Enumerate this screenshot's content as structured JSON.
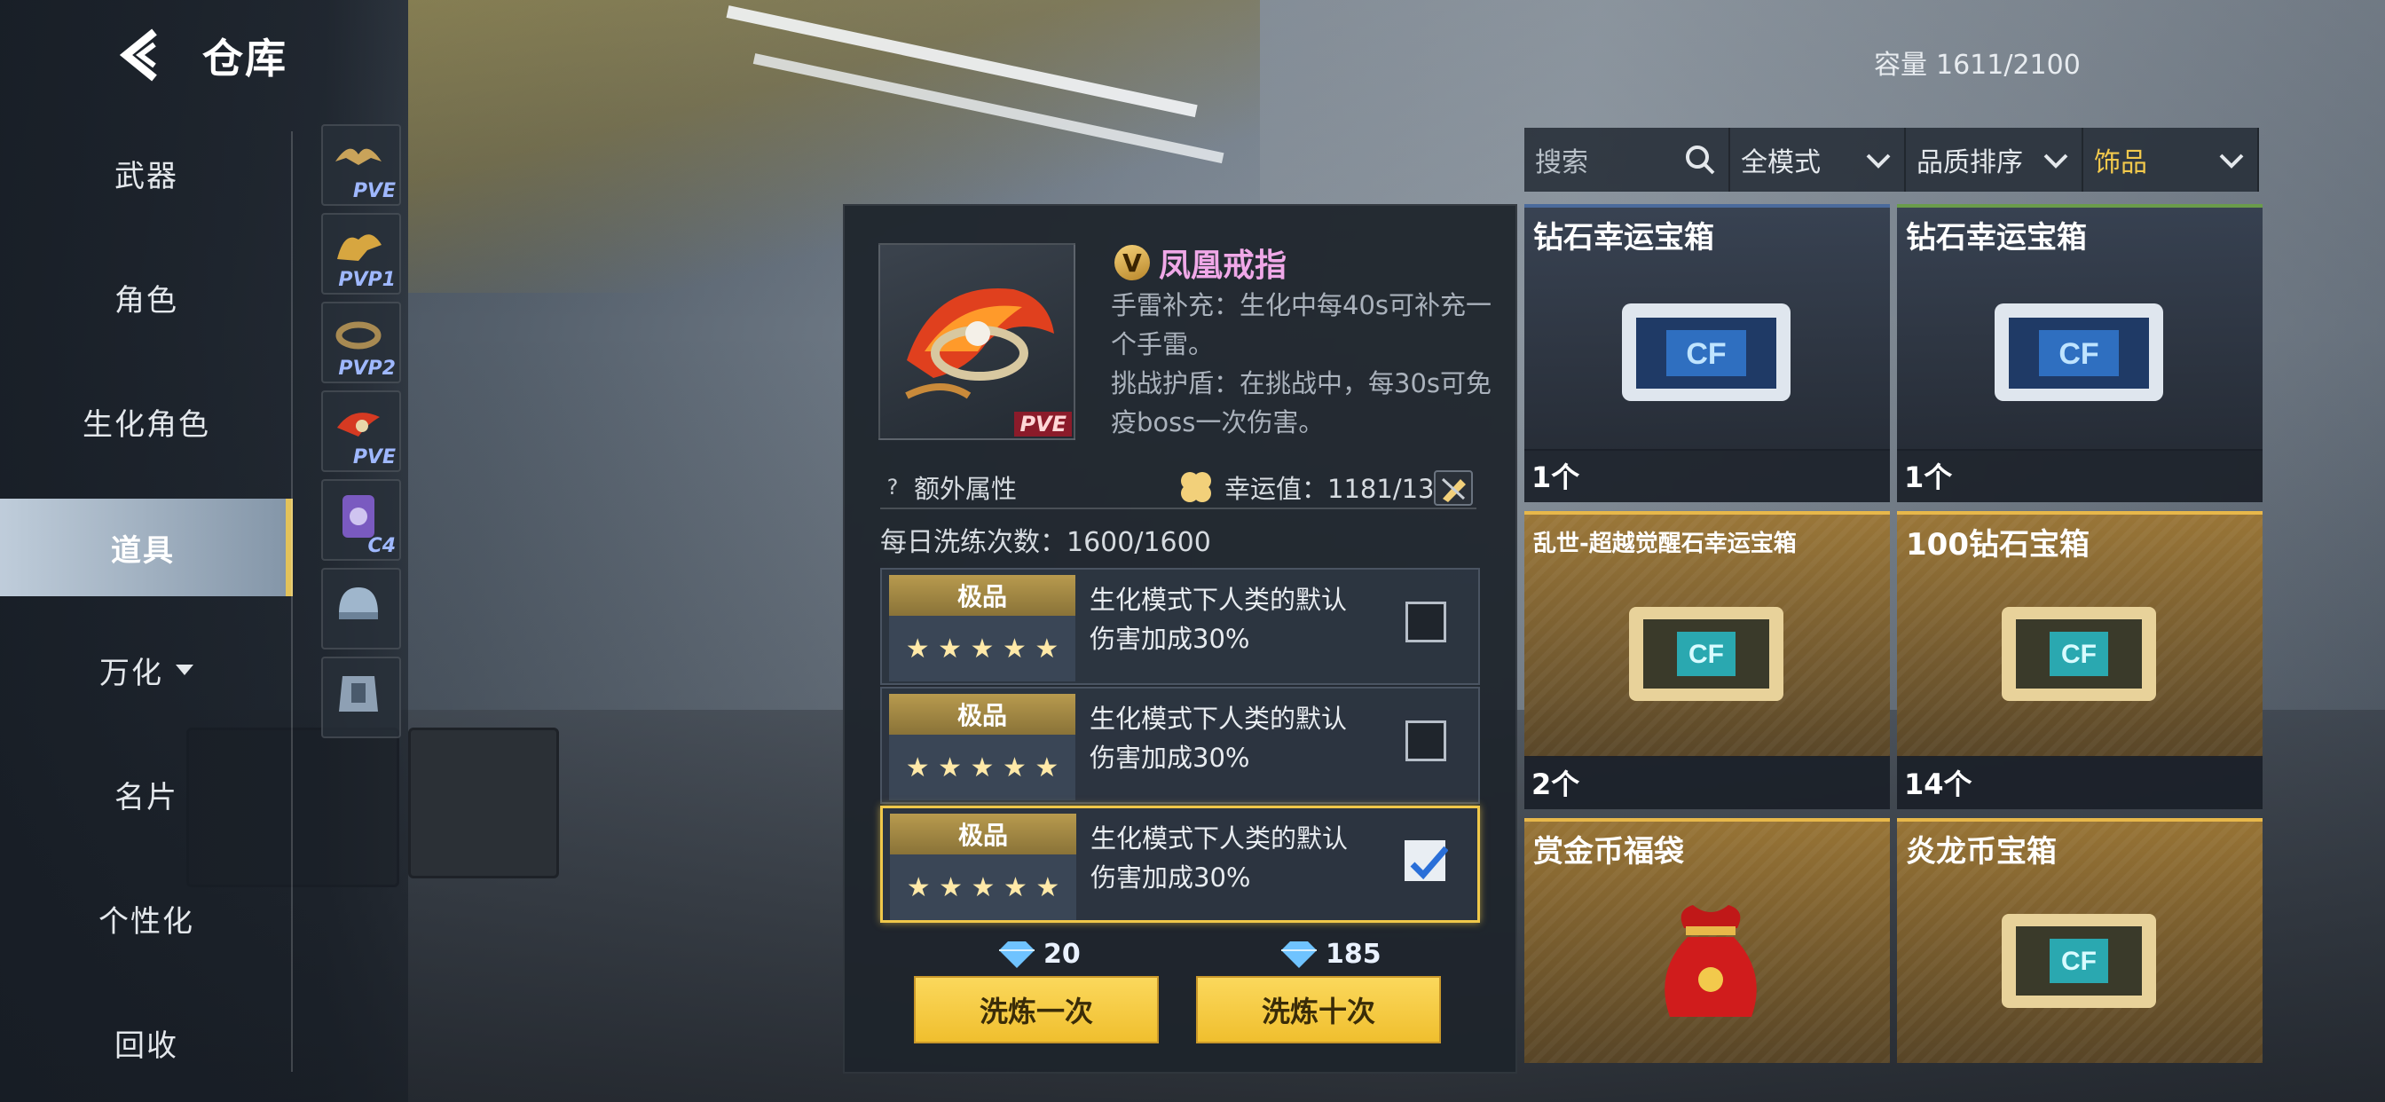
{
  "header": {
    "title": "仓库",
    "capacity_label": "容量",
    "capacity_value": "1611/2100"
  },
  "nav": {
    "items": [
      {
        "label": "武器"
      },
      {
        "label": "角色"
      },
      {
        "label": "生化角色"
      },
      {
        "label": "道具",
        "active": true
      },
      {
        "label": "万化"
      },
      {
        "label": "名片"
      },
      {
        "label": "个性化"
      },
      {
        "label": "回收"
      }
    ]
  },
  "subcategories": [
    {
      "tag": "PVE",
      "icon": "wings-icon"
    },
    {
      "tag": "PVP1",
      "icon": "wings-icon"
    },
    {
      "tag": "PVP2",
      "icon": "bracelet-icon"
    },
    {
      "tag": "PVE",
      "icon": "phoenix-ring-icon"
    },
    {
      "tag": "C4",
      "icon": "c4-icon"
    },
    {
      "tag": "",
      "icon": "helmet-icon"
    },
    {
      "tag": "",
      "icon": "armor-icon"
    }
  ],
  "detail": {
    "thumb_tag": "PVE",
    "name": "凤凰戒指",
    "desc1": "手雷补充：生化中每40s可补充一个手雷。",
    "desc2": "挑战护盾：在挑战中，每30s可免疫boss一次伤害。",
    "extra_attr_label": "额外属性",
    "luck_label": "幸运值：1181/1300",
    "daily_label": "每日洗练次数：1600/1600",
    "options": [
      {
        "grade": "极品",
        "stars": "★ ★ ★ ★ ★",
        "text": "生化模式下人类的默认伤害加成30%",
        "checked": false
      },
      {
        "grade": "极品",
        "stars": "★ ★ ★ ★ ★",
        "text": "生化模式下人类的默认伤害加成30%",
        "checked": false
      },
      {
        "grade": "极品",
        "stars": "★ ★ ★ ★ ★",
        "text": "生化模式下人类的默认伤害加成30%",
        "checked": true
      }
    ],
    "cost_once": "20",
    "cost_ten": "185",
    "btn_once": "洗炼一次",
    "btn_ten": "洗炼十次"
  },
  "filters": {
    "search_placeholder": "搜索",
    "mode": "全模式",
    "sort": "品质排序",
    "category": "饰品"
  },
  "items": [
    {
      "name": "钻石幸运宝箱",
      "count": "1个",
      "icon": "silver-chest-icon"
    },
    {
      "name": "钻石幸运宝箱",
      "count": "1个",
      "icon": "silver-chest-icon"
    },
    {
      "name": "乱世-超越觉醒石幸运宝箱",
      "count": "2个",
      "icon": "gold-chest-icon"
    },
    {
      "name": "100钻石宝箱",
      "count": "14个",
      "icon": "gold-chest-icon"
    },
    {
      "name": "赏金币福袋",
      "icon": "red-lucky-bag-icon"
    },
    {
      "name": "炎龙币宝箱",
      "icon": "gold-chest-icon"
    }
  ],
  "colors": {
    "accent_gold": "#f2c94c",
    "item_name_pink": "#f0a8e8",
    "button_yellow": "#f7cd45"
  }
}
